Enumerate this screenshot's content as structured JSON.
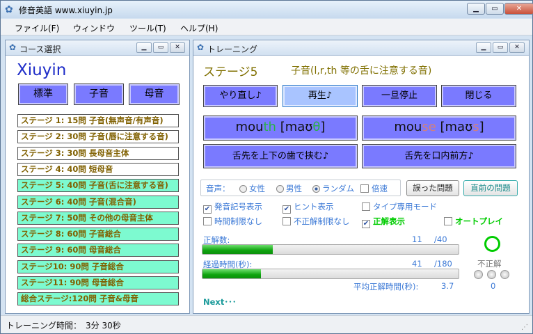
{
  "window": {
    "title": "修音英語 www.xiuyin.jp"
  },
  "menu": [
    "ファイル(F)",
    "ウィンドウ",
    "ツール(T)",
    "ヘルプ(H)"
  ],
  "course_panel": {
    "title": "コース選択",
    "brand": "Xiuyin",
    "buttons": [
      "標準",
      "子音",
      "母音"
    ],
    "stages": [
      {
        "label": "ステージ 1: 15問 子音(無声音/有声音)",
        "color": "white"
      },
      {
        "label": "ステージ 2: 30問 子音(唇に注意する音)",
        "color": "white"
      },
      {
        "label": "ステージ 3: 30問 長母音主体",
        "color": "white"
      },
      {
        "label": "ステージ 4: 40問 短母音",
        "color": "white"
      },
      {
        "label": "ステージ 5: 40問 子音(舌に注意する音)",
        "color": "aqua"
      },
      {
        "label": "ステージ 6: 40問 子音(混合音)",
        "color": "aqua"
      },
      {
        "label": "ステージ 7: 50問 その他の母音主体",
        "color": "aqua"
      },
      {
        "label": "ステージ 8: 60問 子音総合",
        "color": "aqua"
      },
      {
        "label": "ステージ 9: 60問 母音総合",
        "color": "aqua"
      },
      {
        "label": "ステージ10: 90問 子音総合",
        "color": "aqua"
      },
      {
        "label": "ステージ11: 90問 母音総合",
        "color": "aqua"
      },
      {
        "label": "総合ステージ:120問 子音&母音",
        "color": "aqua"
      }
    ]
  },
  "training_panel": {
    "title": "トレーニング",
    "stage_title": "ステージ5",
    "stage_subtitle": "子音(l,r,th 等の舌に注意する音)",
    "controls": [
      "やり直し♪",
      "再生♪",
      "一旦停止",
      "閉じる"
    ],
    "choices": [
      {
        "pre": "mou",
        "hl": "th",
        "mid": " [maʊ",
        "hl2": "θ",
        "post": "]",
        "style": "hl"
      },
      {
        "pre": "mou",
        "hl": "se",
        "mid": " [maʊ",
        "hl2": "s",
        "post": "]",
        "style": "hl2"
      }
    ],
    "hints": [
      "舌先を上下の歯で挟む♪",
      "舌先を口内前方♪"
    ],
    "voice": {
      "label": "音声：",
      "options": [
        "女性",
        "男性",
        "ランダム"
      ],
      "selected": "ランダム",
      "speed_label": "倍速"
    },
    "review_buttons": [
      "誤った問題",
      "直前の問題"
    ],
    "options_row1": [
      {
        "label": "発音記号表示",
        "checked": true
      },
      {
        "label": "ヒント表示",
        "checked": true
      },
      {
        "label": "タイプ専用モード",
        "checked": false
      }
    ],
    "options_row2": [
      {
        "label": "時間制限なし",
        "checked": false
      },
      {
        "label": "不正解制限なし",
        "checked": false
      },
      {
        "label": "正解表示",
        "checked": true
      },
      {
        "label": "オートプレイ",
        "checked": false
      }
    ],
    "correct": {
      "label": "正解数:",
      "value": "11",
      "total": "/40",
      "fraction": 0.275
    },
    "elapsed": {
      "label": "経過時間(秒):",
      "value": "41",
      "total": "/180",
      "fraction": 0.228
    },
    "avg": {
      "label": "平均正解時間(秒):",
      "value": "3.7"
    },
    "incorrect": {
      "label": "不正解",
      "value": "0"
    },
    "next_label": "Next･･･",
    "accent_green": "#00cc00"
  },
  "status": {
    "text": "トレーニング時間：　3分 30秒"
  }
}
